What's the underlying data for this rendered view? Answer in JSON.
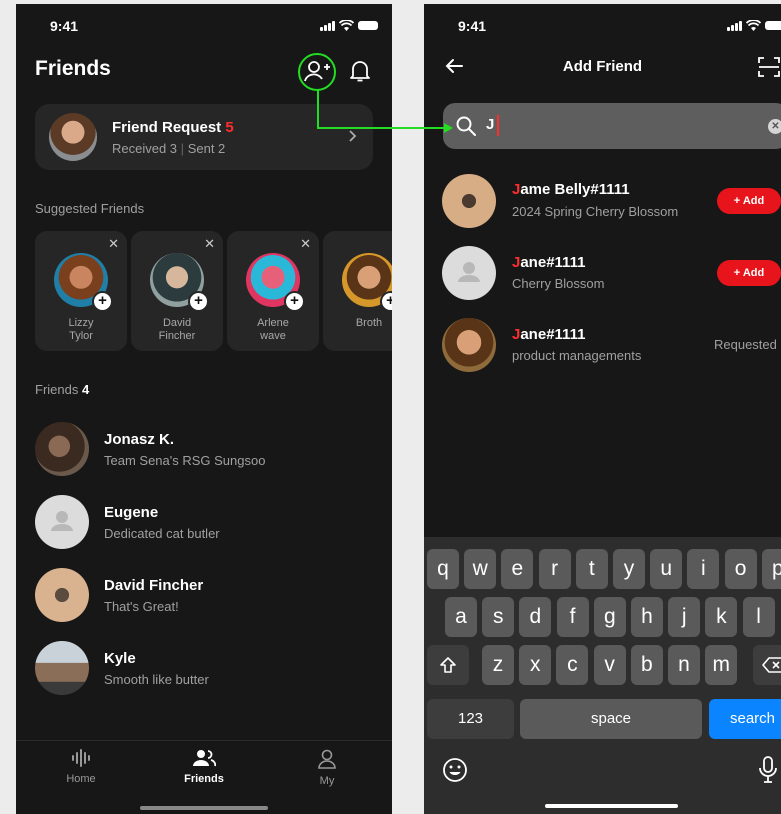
{
  "status": {
    "time": "9:41"
  },
  "friends_screen": {
    "title": "Friends",
    "request_card": {
      "title": "Friend Request",
      "count": "5",
      "received": "Received 3",
      "sent": "Sent 2"
    },
    "suggested_label": "Suggested Friends",
    "suggested": [
      {
        "name": "Lizzy\nTylor"
      },
      {
        "name": "David\nFincher"
      },
      {
        "name": "Arlene\nwave"
      },
      {
        "name": "Broth"
      }
    ],
    "friends_label": "Friends",
    "friends_count": "4",
    "friends": [
      {
        "name": "Jonasz K.",
        "status": "Team Sena's RSG Sungsoo"
      },
      {
        "name": "Eugene",
        "status": "Dedicated cat butler"
      },
      {
        "name": "David Fincher",
        "status": "That's Great!"
      },
      {
        "name": "Kyle",
        "status": "Smooth like butter"
      }
    ],
    "tabs": [
      {
        "label": "Home",
        "icon": "waveform-icon",
        "active": false
      },
      {
        "label": "Friends",
        "icon": "people-icon",
        "active": true
      },
      {
        "label": "My",
        "icon": "person-icon",
        "active": false
      }
    ]
  },
  "add_friend_screen": {
    "title": "Add Friend",
    "search": {
      "value": "J"
    },
    "results": [
      {
        "highlight": "J",
        "name_rest": "ame Belly#1111",
        "status": "2024 Spring Cherry Blossom",
        "action": "+ Add"
      },
      {
        "highlight": "J",
        "name_rest": "ane#1111",
        "status": "Cherry Blossom",
        "action": "+ Add"
      },
      {
        "highlight": "J",
        "name_rest": "ane#1111",
        "status": "product managements",
        "action": "Requested"
      }
    ],
    "keyboard": {
      "row1": [
        "q",
        "w",
        "e",
        "r",
        "t",
        "y",
        "u",
        "i",
        "o",
        "p"
      ],
      "row2": [
        "a",
        "s",
        "d",
        "f",
        "g",
        "h",
        "j",
        "k",
        "l"
      ],
      "row3": [
        "z",
        "x",
        "c",
        "v",
        "b",
        "n",
        "m"
      ],
      "numbers_key": "123",
      "space_key": "space",
      "search_key": "search"
    }
  },
  "colors": {
    "accent_green": "#22dd22",
    "accent_red": "#e8141c",
    "keyboard_blue": "#0a84ff"
  }
}
